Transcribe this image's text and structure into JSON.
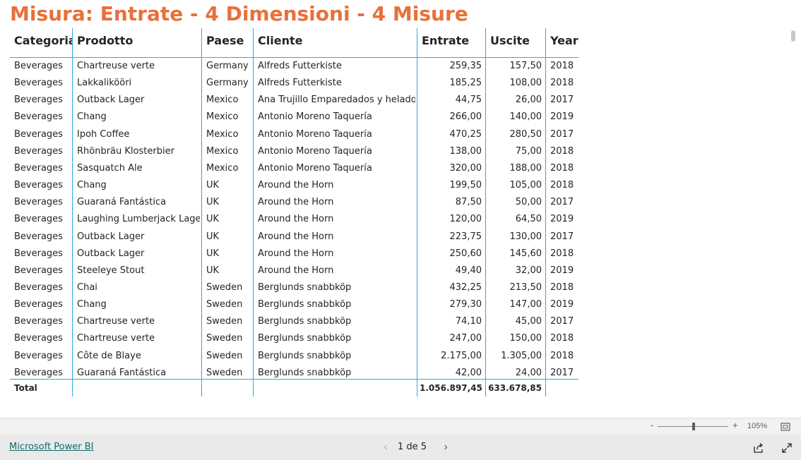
{
  "title": "Misura: Entrate - 4 Dimensioni - 4 Misure",
  "table": {
    "headers": [
      "Categoria",
      "Prodotto",
      "Paese",
      "Cliente",
      "Entrate",
      "Uscite",
      "Year"
    ],
    "rows": [
      [
        "Beverages",
        "Chartreuse verte",
        "Germany",
        "Alfreds Futterkiste",
        "259,35",
        "157,50",
        "2018"
      ],
      [
        "Beverages",
        "Lakkalikööri",
        "Germany",
        "Alfreds Futterkiste",
        "185,25",
        "108,00",
        "2018"
      ],
      [
        "Beverages",
        "Outback Lager",
        "Mexico",
        "Ana Trujillo Emparedados y helados",
        "44,75",
        "26,00",
        "2017"
      ],
      [
        "Beverages",
        "Chang",
        "Mexico",
        "Antonio Moreno Taquería",
        "266,00",
        "140,00",
        "2019"
      ],
      [
        "Beverages",
        "Ipoh Coffee",
        "Mexico",
        "Antonio Moreno Taquería",
        "470,25",
        "280,50",
        "2017"
      ],
      [
        "Beverages",
        "Rhönbräu Klosterbier",
        "Mexico",
        "Antonio Moreno Taquería",
        "138,00",
        "75,00",
        "2018"
      ],
      [
        "Beverages",
        "Sasquatch Ale",
        "Mexico",
        "Antonio Moreno Taquería",
        "320,00",
        "188,00",
        "2018"
      ],
      [
        "Beverages",
        "Chang",
        "UK",
        "Around the Horn",
        "199,50",
        "105,00",
        "2018"
      ],
      [
        "Beverages",
        "Guaraná Fantástica",
        "UK",
        "Around the Horn",
        "87,50",
        "50,00",
        "2017"
      ],
      [
        "Beverages",
        "Laughing Lumberjack Lager",
        "UK",
        "Around the Horn",
        "120,00",
        "64,50",
        "2019"
      ],
      [
        "Beverages",
        "Outback Lager",
        "UK",
        "Around the Horn",
        "223,75",
        "130,00",
        "2017"
      ],
      [
        "Beverages",
        "Outback Lager",
        "UK",
        "Around the Horn",
        "250,60",
        "145,60",
        "2018"
      ],
      [
        "Beverages",
        "Steeleye Stout",
        "UK",
        "Around the Horn",
        "49,40",
        "32,00",
        "2019"
      ],
      [
        "Beverages",
        "Chai",
        "Sweden",
        "Berglunds snabbköp",
        "432,25",
        "213,50",
        "2018"
      ],
      [
        "Beverages",
        "Chang",
        "Sweden",
        "Berglunds snabbköp",
        "279,30",
        "147,00",
        "2019"
      ],
      [
        "Beverages",
        "Chartreuse verte",
        "Sweden",
        "Berglunds snabbköp",
        "74,10",
        "45,00",
        "2017"
      ],
      [
        "Beverages",
        "Chartreuse verte",
        "Sweden",
        "Berglunds snabbköp",
        "247,00",
        "150,00",
        "2018"
      ],
      [
        "Beverages",
        "Côte de Blaye",
        "Sweden",
        "Berglunds snabbköp",
        "2.175,00",
        "1.305,00",
        "2018"
      ],
      [
        "Beverages",
        "Guaraná Fantástica",
        "Sweden",
        "Berglunds snabbköp",
        "42,00",
        "24,00",
        "2017"
      ]
    ],
    "total": {
      "label": "Total",
      "entrate": "1.056.897,45",
      "uscite": "633.678,85"
    }
  },
  "zoom": {
    "minus": "-",
    "plus": "+",
    "level": "105%"
  },
  "footer": {
    "brand_link": "Microsoft Power BI",
    "page_indicator": "1 de 5",
    "prev": "‹",
    "next": "›"
  },
  "colors": {
    "title": "#e8703a",
    "grid": "#2fa7e1",
    "link": "#0f6b6b"
  }
}
